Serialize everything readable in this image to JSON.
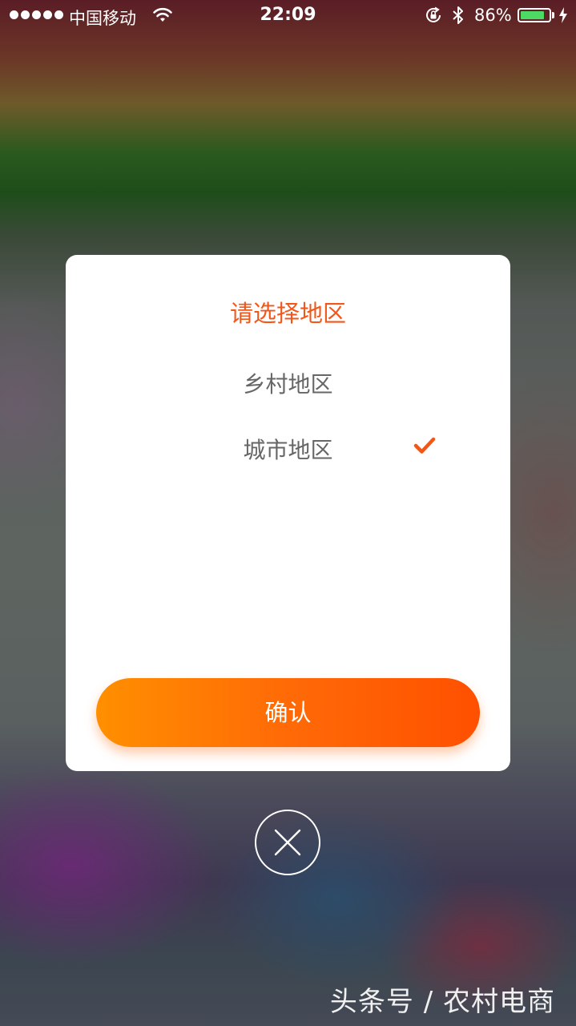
{
  "status_bar": {
    "carrier": "中国移动",
    "time": "22:09",
    "battery_percent": "86%",
    "battery_level": 0.86,
    "icons": [
      "signal-dots-icon",
      "wifi-icon",
      "rotation-lock-icon",
      "bluetooth-icon",
      "battery-icon",
      "charging-icon"
    ]
  },
  "dialog": {
    "title": "请选择地区",
    "options": [
      {
        "label": "乡村地区",
        "selected": false
      },
      {
        "label": "城市地区",
        "selected": true
      }
    ],
    "confirm_label": "确认"
  },
  "close": {
    "icon": "close-icon"
  },
  "watermark": "头条号 / 农村电商",
  "colors": {
    "accent": "#f2571a",
    "button_gradient_start": "#ff8f00",
    "button_gradient_end": "#ff5000",
    "option_text": "#666666",
    "battery_fill": "#4cd964"
  }
}
